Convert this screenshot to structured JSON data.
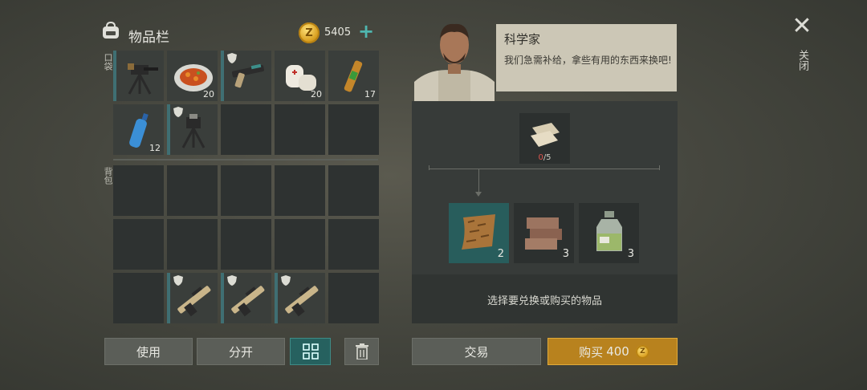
{
  "inventory": {
    "title": "物品栏",
    "money": "5405",
    "pocket_label": "口袋",
    "backpack_label": "背包",
    "pocket_items": [
      {
        "icon": "turret-icon",
        "count": ""
      },
      {
        "icon": "food-plate-icon",
        "count": "20"
      },
      {
        "icon": "pistol-icon",
        "count": ""
      },
      {
        "icon": "bandage-icon",
        "count": "20"
      },
      {
        "icon": "injector-icon",
        "count": "17"
      },
      {
        "icon": "water-bottle-icon",
        "count": "12"
      },
      {
        "icon": "turret-icon",
        "count": ""
      }
    ],
    "backpack_items": [
      {
        "icon": "rifle-icon",
        "count": ""
      },
      {
        "icon": "rifle-icon",
        "count": ""
      },
      {
        "icon": "rifle-icon",
        "count": ""
      }
    ]
  },
  "buttons": {
    "use": "使用",
    "split": "分开",
    "trade": "交易",
    "buy": "购买",
    "buy_price": "400"
  },
  "npc": {
    "name": "科学家",
    "dialog": "我们急需补给，拿些有用的东西来换吧!"
  },
  "trade": {
    "required_have": "0",
    "required_need": "/5",
    "required_icon": "cloth-icon",
    "rewards": [
      {
        "icon": "leather-icon",
        "count": "2"
      },
      {
        "icon": "bricks-icon",
        "count": "3"
      },
      {
        "icon": "chemical-jar-icon",
        "count": "3"
      }
    ],
    "hint": "选择要兑换或购买的物品"
  },
  "close": {
    "label": "关闭"
  },
  "colors": {
    "accent": "#3f6f73",
    "buy": "#b8821e",
    "selected": "#285d5c"
  }
}
